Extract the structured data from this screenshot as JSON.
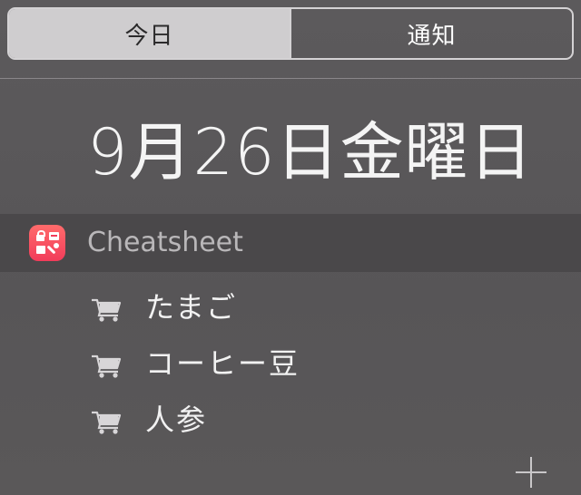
{
  "tabs": [
    {
      "label": "今日",
      "active": true
    },
    {
      "label": "通知",
      "active": false
    }
  ],
  "date_label": "9月26日金曜日",
  "widget": {
    "app_name": "Cheatsheet",
    "app_icon": "cheatsheet-app-icon",
    "accent_color": "#f23c5a",
    "items": [
      {
        "icon": "shopping-cart-icon",
        "label": "たまご"
      },
      {
        "icon": "shopping-cart-icon",
        "label": "コーヒー豆"
      },
      {
        "icon": "shopping-cart-icon",
        "label": "人参"
      }
    ],
    "add_icon": "plus-icon"
  }
}
